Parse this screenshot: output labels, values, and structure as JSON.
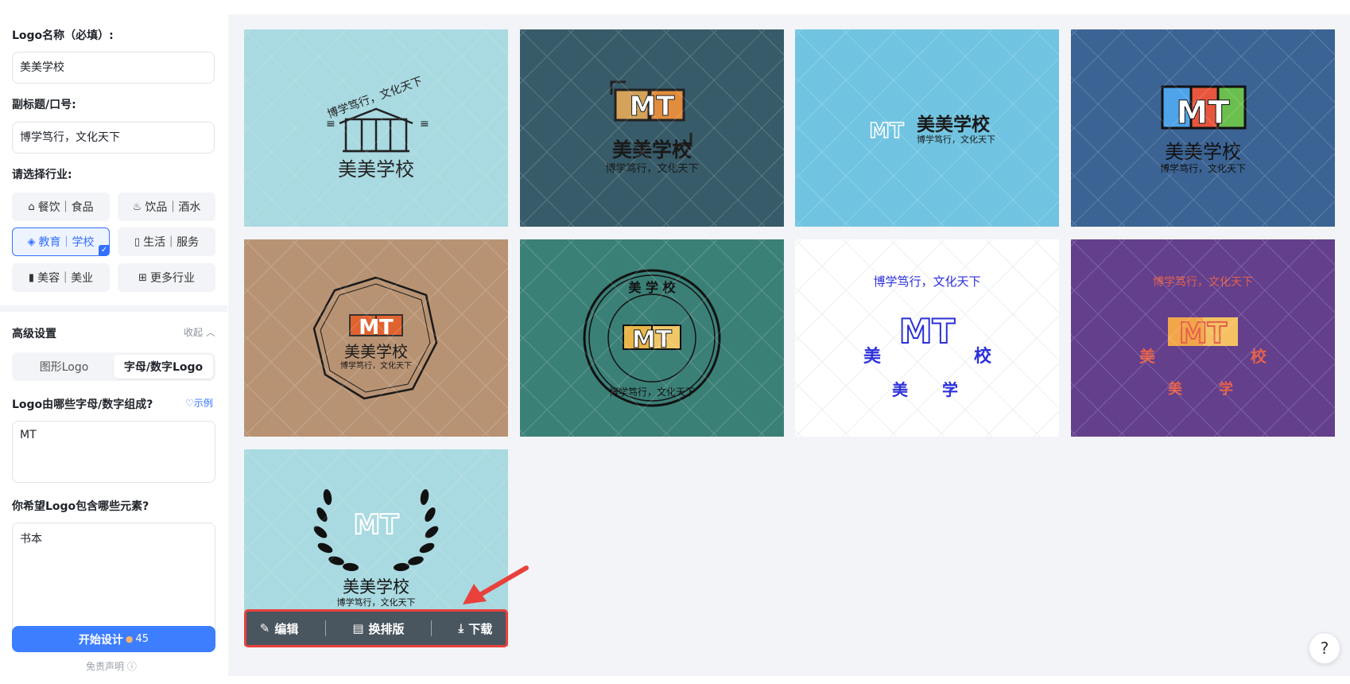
{
  "sidebar": {
    "name_label": "Logo名称（必填）:",
    "name_value": "美美学校",
    "subtitle_label": "副标题/口号:",
    "subtitle_value": "博学笃行，文化天下",
    "industry_label": "请选择行业:",
    "industries": [
      {
        "label": "餐饮｜食品",
        "icon": "cloche-icon"
      },
      {
        "label": "饮品｜酒水",
        "icon": "cup-icon"
      },
      {
        "label": "教育｜学校",
        "icon": "graduation-icon"
      },
      {
        "label": "生活｜服务",
        "icon": "phone-icon"
      },
      {
        "label": "美容｜美业",
        "icon": "lipstick-icon"
      },
      {
        "label": "更多行业",
        "icon": "grid-icon"
      }
    ],
    "advanced_label": "高级设置",
    "collapse_label": "收起",
    "tabs": [
      "图形Logo",
      "字母/数字Logo"
    ],
    "letters_label": "Logo由哪些字母/数字组成?",
    "example_label": "示例",
    "letters_value": "MT",
    "elements_label": "你希望Logo包含哪些元素?",
    "elements_value": "书本",
    "start_button": "开始设计",
    "cost": "45",
    "disclaimer": "免责声明"
  },
  "logos": {
    "name": "美美学校",
    "slogan": "博学笃行，文化天下",
    "initials": "MT",
    "card_colors": [
      "#a9d9e1",
      "#375b69",
      "#71c4e1",
      "#3b6393",
      "#b89373",
      "#3b8077",
      "#ffffff",
      "#633f8c",
      "#a9d9e1"
    ]
  },
  "toolbar": {
    "edit": "编辑",
    "relayout": "换排版",
    "download": "下载"
  },
  "help": "?"
}
